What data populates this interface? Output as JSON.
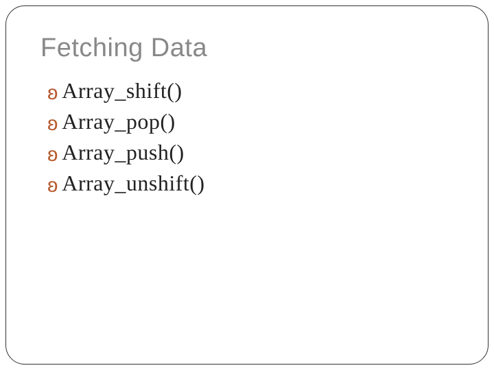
{
  "slide": {
    "title": "Fetching Data",
    "bullets": [
      {
        "icon": "ʚ",
        "text": "Array_shift()"
      },
      {
        "icon": "ʚ",
        "text": "Array_pop()"
      },
      {
        "icon": "ʚ",
        "text": "Array_push()"
      },
      {
        "icon": "ʚ",
        "text": "Array_unshift()"
      }
    ]
  }
}
